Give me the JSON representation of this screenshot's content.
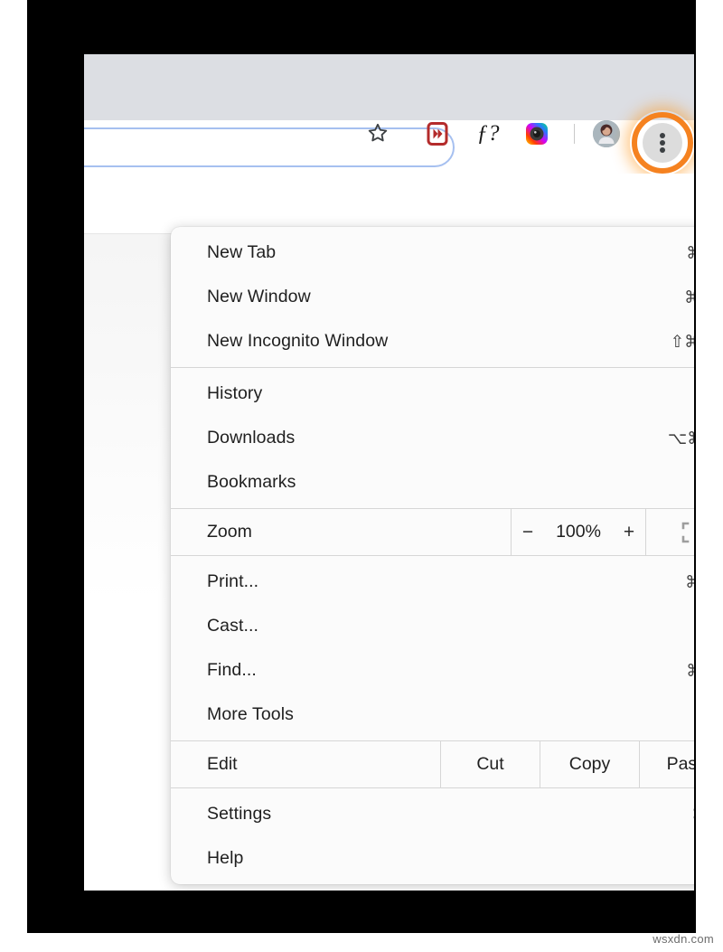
{
  "browser": {
    "toolbar": {
      "bookmark_icon": "star-icon",
      "extensions": [
        {
          "name": "fast-forward-extension-icon",
          "glyph": "▶▶"
        },
        {
          "name": "function-question-extension-icon",
          "glyph": "ƒ?"
        },
        {
          "name": "camera-extension-icon",
          "glyph": "camera"
        }
      ],
      "avatar": "profile-avatar",
      "menu_button": "three-dot-menu-button",
      "highlight_color": "#f58220"
    },
    "tabstrip_color": "#dcdee3"
  },
  "menu": {
    "groups": [
      {
        "items": [
          {
            "label": "New Tab",
            "accel": "⌘T",
            "submenu": false
          },
          {
            "label": "New Window",
            "accel": "⌘N",
            "submenu": false
          },
          {
            "label": "New Incognito Window",
            "accel": "⇧⌘N",
            "submenu": false
          }
        ]
      },
      {
        "items": [
          {
            "label": "History",
            "accel": "",
            "submenu": true
          },
          {
            "label": "Downloads",
            "accel": "⌥⌘L",
            "submenu": false
          },
          {
            "label": "Bookmarks",
            "accel": "",
            "submenu": true
          }
        ]
      }
    ],
    "zoom_row": {
      "label": "Zoom",
      "minus": "−",
      "value": "100%",
      "plus": "+",
      "fullscreen_icon": "fullscreen-icon"
    },
    "tools_group": {
      "items": [
        {
          "label": "Print...",
          "accel": "⌘P",
          "submenu": false
        },
        {
          "label": "Cast...",
          "accel": "",
          "submenu": false
        },
        {
          "label": "Find...",
          "accel": "⌘F",
          "submenu": false
        },
        {
          "label": "More Tools",
          "accel": "",
          "submenu": true
        }
      ]
    },
    "edit_row": {
      "label": "Edit",
      "cut": "Cut",
      "copy": "Copy",
      "paste": "Paste"
    },
    "footer_group": {
      "items": [
        {
          "label": "Settings",
          "accel": "⌘,",
          "submenu": false
        },
        {
          "label": "Help",
          "accel": "",
          "submenu": true
        }
      ]
    }
  },
  "watermark": "wsxdn.com"
}
